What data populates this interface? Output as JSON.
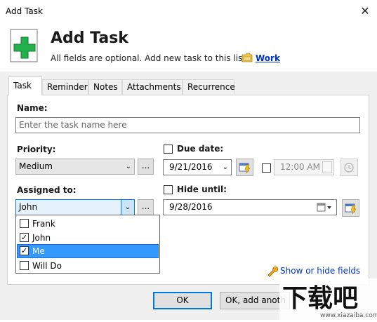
{
  "window": {
    "title": "Add Task",
    "close_glyph": "✕"
  },
  "header": {
    "title": "Add Task",
    "subtitle": "All fields are optional. Add new task to this list:",
    "list_name": "Work"
  },
  "tabs": [
    "Task",
    "Reminder",
    "Notes",
    "Attachments",
    "Recurrence"
  ],
  "form": {
    "name_label": "Name:",
    "name_placeholder": "Enter the task name here",
    "priority_label": "Priority:",
    "priority_value": "Medium",
    "due_label": "Due date:",
    "due_date": "9/21/2016",
    "due_time": "12:00 AM",
    "assigned_label": "Assigned to:",
    "assigned_value": "John",
    "hide_label": "Hide until:",
    "hide_date": "9/28/2016",
    "ellipsis": "..."
  },
  "dropdown_options": [
    {
      "label": "Frank",
      "checked": false
    },
    {
      "label": "John",
      "checked": true
    },
    {
      "label": "Me",
      "checked": true,
      "selected": true
    },
    {
      "label": "Will Do",
      "checked": false
    }
  ],
  "show_hide_label": "Show or hide fields",
  "buttons": {
    "ok": "OK",
    "ok_add": "OK, add anoth"
  },
  "watermark": {
    "main": "下载吧",
    "url": "www.xiazaiba.com"
  },
  "colors": {
    "accent": "#3399ff",
    "link": "#0033cc",
    "icon_green": "#22b14c"
  }
}
